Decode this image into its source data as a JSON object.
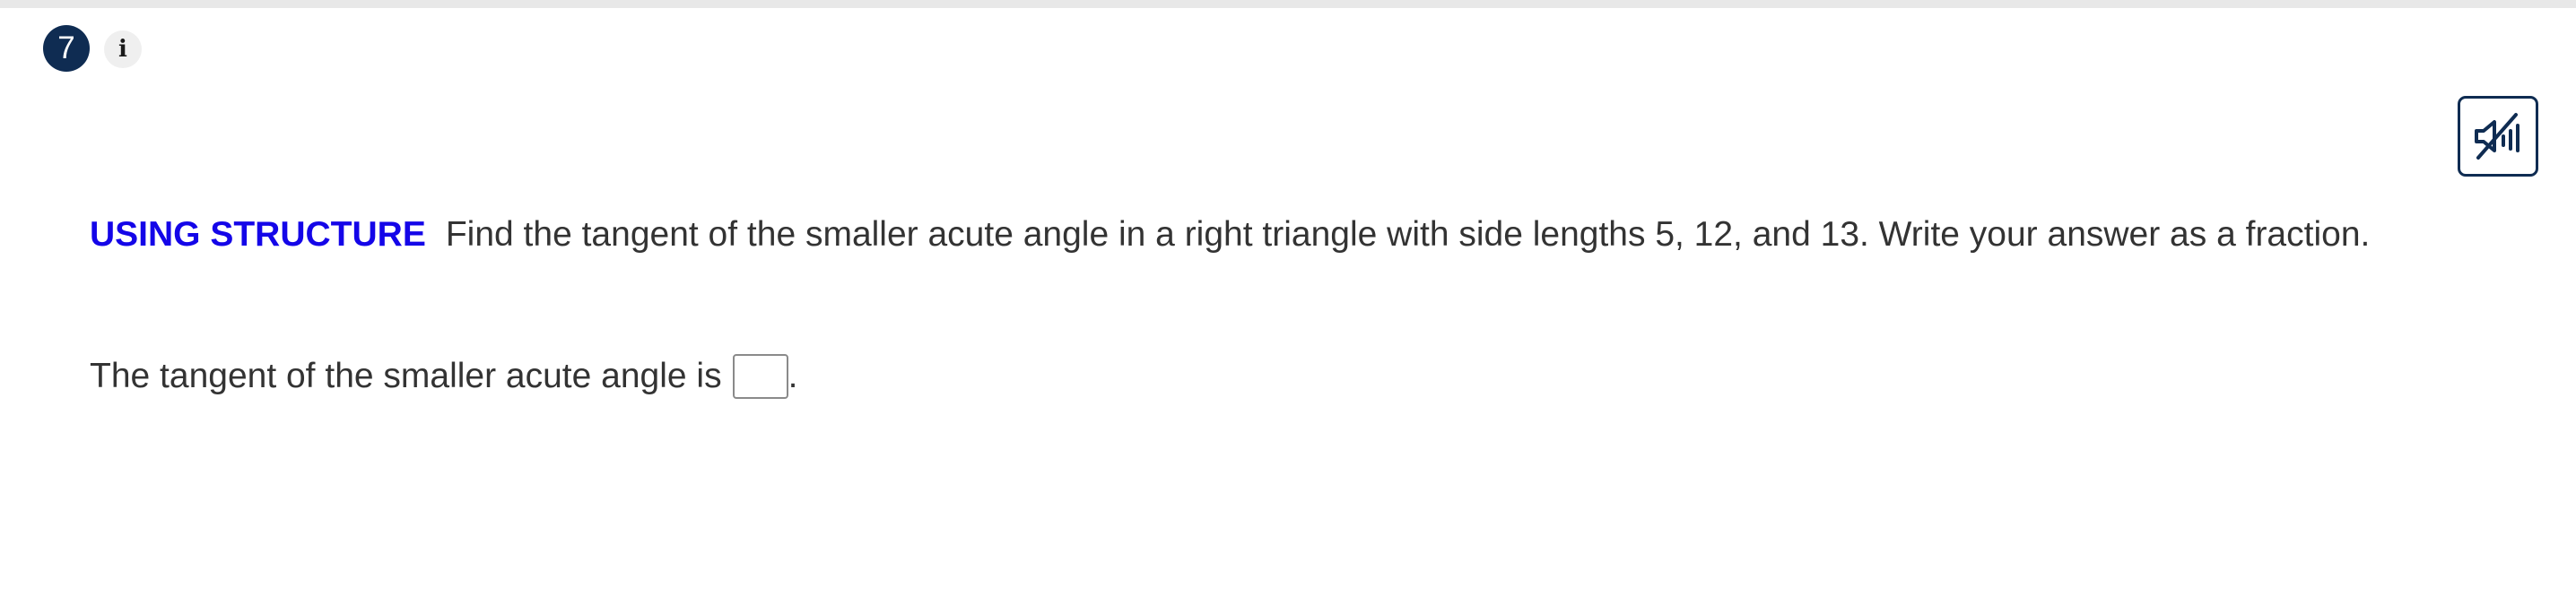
{
  "question": {
    "number": "7",
    "info_label": "i",
    "info_icon": "info-icon"
  },
  "toolbar": {
    "audio_icon": "speaker-muted-icon",
    "accent_color": "#0f2c52"
  },
  "prompt": {
    "label": "USING STRUCTURE",
    "label_color": "#1405e8",
    "text": "Find the tangent of the smaller acute angle in a right triangle with side lengths 5, 12, and 13. Write your answer as a fraction."
  },
  "answer": {
    "lead_text": "The tangent of the smaller acute angle is",
    "input_value": "",
    "trailing_text": "."
  }
}
